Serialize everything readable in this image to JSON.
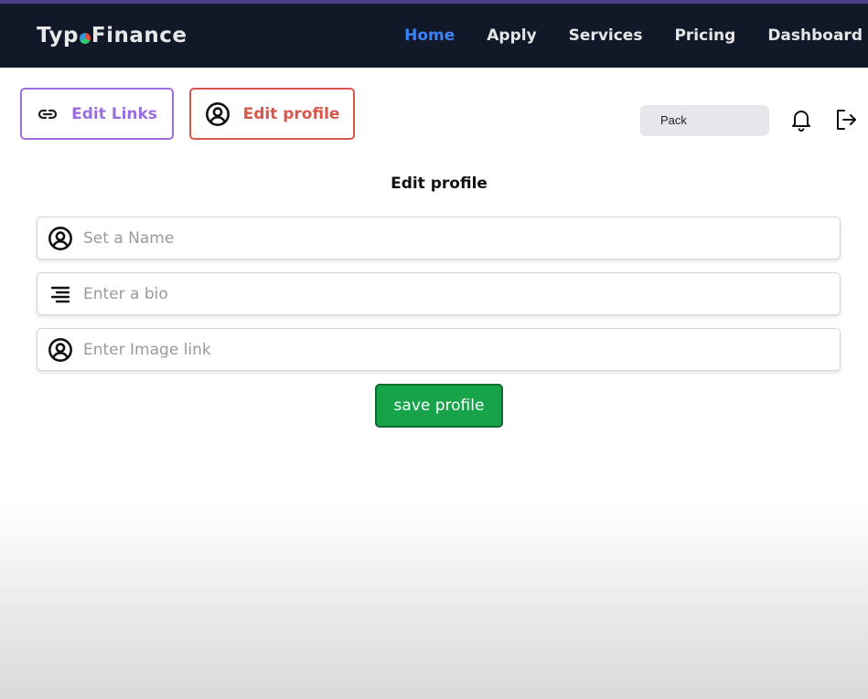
{
  "header": {
    "logo_left": "Typ",
    "logo_right": "Finance",
    "nav": [
      {
        "label": "Home",
        "active": true
      },
      {
        "label": "Apply"
      },
      {
        "label": "Services"
      },
      {
        "label": "Pricing"
      },
      {
        "label": "Dashboard"
      }
    ]
  },
  "tabs": {
    "edit_links": "Edit Links",
    "edit_profile": "Edit profile"
  },
  "toolbar": {
    "pack_label": "Pack",
    "icons": [
      "bell-icon",
      "logout-icon"
    ]
  },
  "form": {
    "title": "Edit profile",
    "name_placeholder": "Set a Name",
    "bio_placeholder": "Enter a bio",
    "image_placeholder": "Enter Image link",
    "save_label": "save profile"
  },
  "colors": {
    "nav_bg": "#111827",
    "nav_active": "#3b82f6",
    "edit_links": "#a06ee0",
    "edit_profile": "#d9574a",
    "save_button": "#16a34a"
  }
}
